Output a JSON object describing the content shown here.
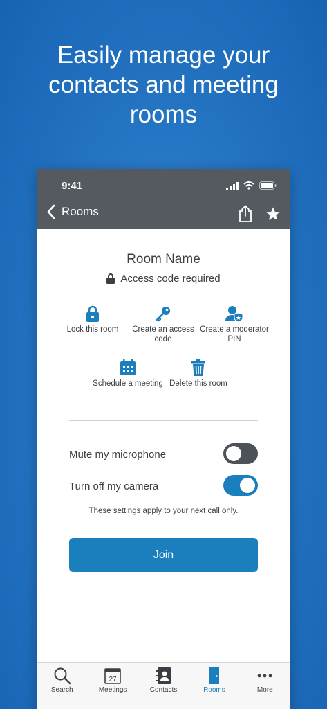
{
  "headline": "Easily manage your contacts and meeting rooms",
  "status": {
    "time": "9:41"
  },
  "nav": {
    "back_label": "Rooms"
  },
  "room": {
    "name": "Room Name",
    "access": "Access code required"
  },
  "actions": [
    {
      "label": "Lock this room",
      "icon": "lock-icon"
    },
    {
      "label": "Create an access code",
      "icon": "key-icon"
    },
    {
      "label": "Create a moderator PIN",
      "icon": "moderator-icon"
    },
    {
      "label": "Schedule a meeting",
      "icon": "calendar-icon"
    },
    {
      "label": "Delete this room",
      "icon": "trash-icon"
    }
  ],
  "settings": {
    "mute_label": "Mute my microphone",
    "mute_on": false,
    "camera_label": "Turn off my camera",
    "camera_on": true,
    "note": "These settings apply to your next call only."
  },
  "join_label": "Join",
  "tabs": [
    {
      "label": "Search",
      "icon": "search-icon"
    },
    {
      "label": "Meetings",
      "icon": "calendar-icon",
      "badge": "27"
    },
    {
      "label": "Contacts",
      "icon": "contacts-icon"
    },
    {
      "label": "Rooms",
      "icon": "door-icon",
      "active": true
    },
    {
      "label": "More",
      "icon": "more-icon"
    }
  ],
  "colors": {
    "accent": "#1b7fbd",
    "header": "#545a5f",
    "toggle_off": "#4c5257",
    "background": "#2576c4"
  }
}
